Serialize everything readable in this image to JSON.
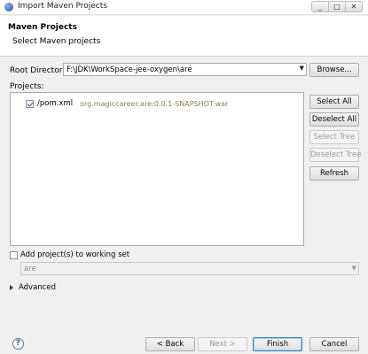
{
  "window": {
    "title": "Import Maven Projects",
    "controls": [
      "_",
      "□",
      "✕"
    ]
  },
  "header": {
    "title": "Maven Projects",
    "description": "Select Maven projects"
  },
  "root_directory": {
    "label": "Root Directory:",
    "value": "F:\\JDK\\WorkSpace-jee-oxygen\\are",
    "browse_label": "Browse..."
  },
  "projects": {
    "label": "Projects:",
    "items": [
      {
        "name": "/pom.xml",
        "artifact": "org.magiccareer:are:0.0.1-SNAPSHOT:war",
        "checked": true
      }
    ]
  },
  "side_buttons": {
    "select_all": "Select All",
    "deselect_all": "Deselect All",
    "select_tree": "Select Tree",
    "deselect_tree": "Deselect Tree",
    "refresh": "Refresh"
  },
  "working_set": {
    "label": "Add project(s) to working set",
    "value": "are"
  },
  "advanced": {
    "label": "Advanced"
  },
  "footer": {
    "help": "?",
    "back": "< Back",
    "next": "Next >",
    "finish": "Finish",
    "cancel": "Cancel"
  }
}
